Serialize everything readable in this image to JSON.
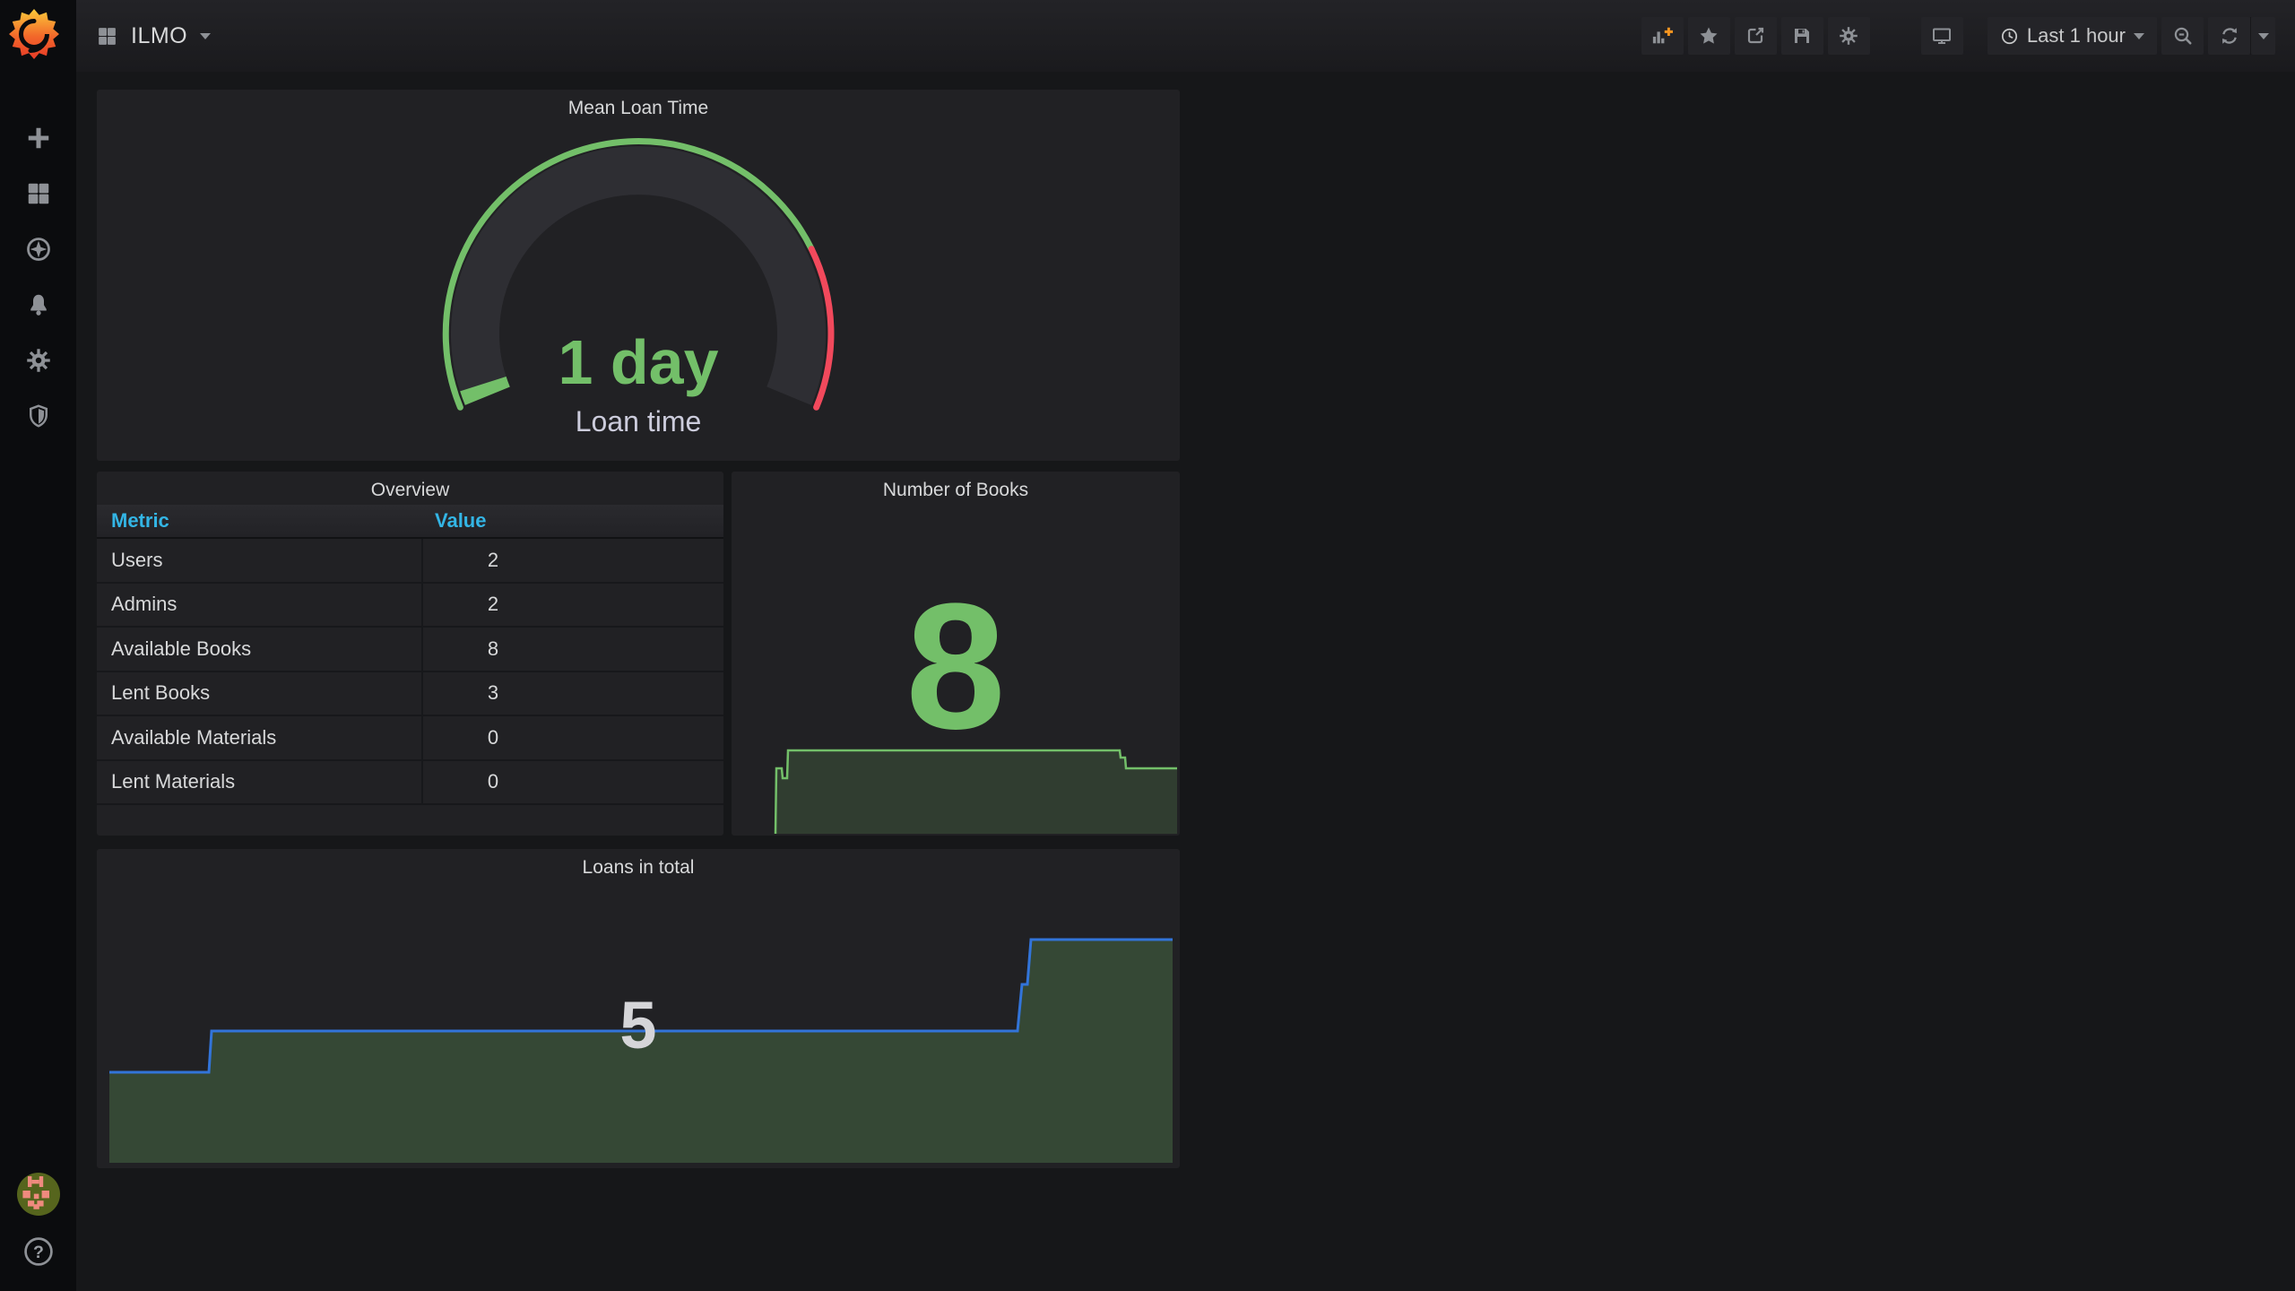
{
  "navbar": {
    "dashboard_title": "ILMO",
    "time_picker": {
      "label": "Last 1 hour"
    }
  },
  "sidebar": {
    "items": [
      {
        "name": "create",
        "icon": "plus-icon"
      },
      {
        "name": "dashboards",
        "icon": "grid-icon"
      },
      {
        "name": "explore",
        "icon": "compass-icon"
      },
      {
        "name": "alerting",
        "icon": "bell-icon"
      },
      {
        "name": "configuration",
        "icon": "gear-icon"
      },
      {
        "name": "server-admin",
        "icon": "shield-icon"
      }
    ],
    "bottom": [
      {
        "name": "user-profile",
        "icon": "avatar"
      },
      {
        "name": "help",
        "icon": "question-icon"
      }
    ]
  },
  "colors": {
    "green": "#73BF69",
    "red": "#F2495C",
    "blue_line": "#3274D9",
    "table_header_blue": "#33b5e5",
    "stat_gray": "#d5d5d8",
    "panel_bg": "#212124",
    "page_bg": "#161719"
  },
  "panels": {
    "gauge": {
      "title": "Mean Loan Time",
      "value_text": "1 day",
      "label": "Loan time",
      "value_color": "#73BF69",
      "threshold_colors": {
        "ok": "#73BF69",
        "alert": "#F2495C"
      }
    },
    "overview": {
      "title": "Overview",
      "columns": {
        "metric": "Metric",
        "value": "Value"
      },
      "rows": [
        {
          "metric": "Users",
          "value": "2"
        },
        {
          "metric": "Admins",
          "value": "2"
        },
        {
          "metric": "Available Books",
          "value": "8"
        },
        {
          "metric": "Lent Books",
          "value": "3"
        },
        {
          "metric": "Available Materials",
          "value": "0"
        },
        {
          "metric": "Lent Materials",
          "value": "0"
        }
      ]
    },
    "books": {
      "title": "Number of Books",
      "value": "8",
      "value_color": "#73BF69",
      "spark": {
        "line_color": "#73BF69",
        "fill_color": "rgba(115,191,105,0.18)",
        "baseline": 404,
        "points": [
          [
            49,
            404
          ],
          [
            50,
            331
          ],
          [
            56,
            331
          ],
          [
            57,
            342
          ],
          [
            62,
            342
          ],
          [
            63,
            311
          ],
          [
            433,
            311
          ],
          [
            434,
            319
          ],
          [
            439,
            319
          ],
          [
            440,
            331
          ],
          [
            497,
            331
          ]
        ]
      }
    },
    "loans": {
      "title": "Loans in total",
      "value": "5",
      "spark": {
        "line_color": "#3274D9",
        "fill_color": "rgba(115,191,105,0.25)",
        "baseline": 350,
        "points": [
          [
            14,
            249
          ],
          [
            125,
            249
          ],
          [
            128,
            203
          ],
          [
            1027,
            203
          ],
          [
            1032,
            151
          ],
          [
            1038,
            151
          ],
          [
            1042,
            101
          ],
          [
            1200,
            101
          ]
        ]
      }
    }
  },
  "chart_data": [
    {
      "type": "gauge",
      "title": "Mean Loan Time",
      "value_text": "1 day",
      "label": "Loan time",
      "gauge_fill_fraction": 0.02,
      "thresholds": [
        {
          "color": "#73BF69",
          "from_fraction": 0
        },
        {
          "color": "#F2495C",
          "from_fraction": 0.79
        }
      ]
    },
    {
      "type": "area",
      "title": "Number of Books",
      "current_value": 8,
      "estimated_values": [
        0,
        8,
        8,
        8,
        8,
        8,
        8,
        8,
        8,
        7.5,
        7.5
      ],
      "legend": "sparkline, no axes shown"
    },
    {
      "type": "area",
      "title": "Loans in total",
      "current_value": 5,
      "estimated_values": [
        3,
        3,
        4,
        4,
        4,
        4,
        4,
        4,
        4.5,
        5,
        5
      ],
      "legend": "sparkline, no axes shown"
    }
  ]
}
